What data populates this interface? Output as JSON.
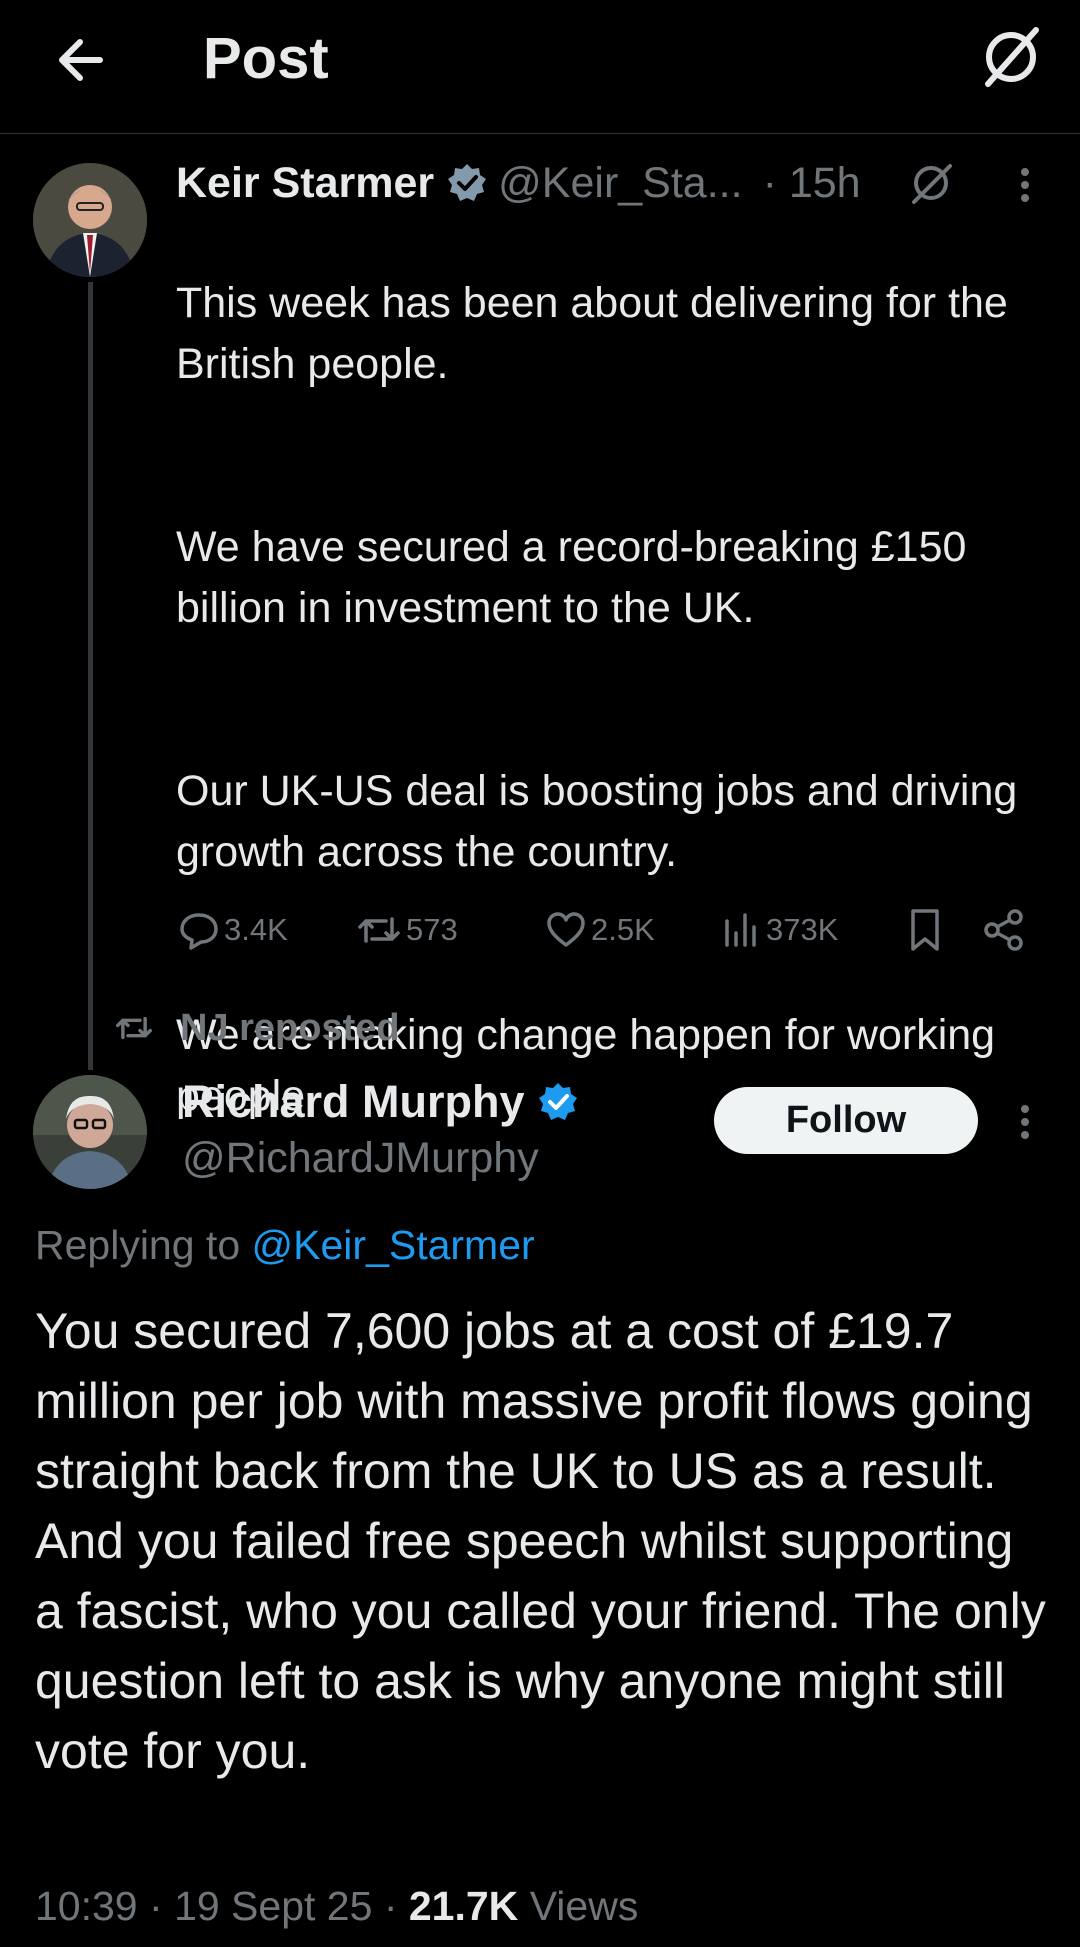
{
  "header": {
    "title": "Post"
  },
  "parent_tweet": {
    "author_name": "Keir Starmer",
    "author_handle": "@Keir_Sta...",
    "time": "· 15h",
    "paragraphs": [
      "This week has been about delivering for the British people.",
      "We have secured a record-breaking £150 billion in investment to the UK.",
      "Our UK-US deal is boosting jobs and driving growth across the country.",
      "We are making change happen for working people."
    ],
    "stats": {
      "replies": "3.4K",
      "reposts": "573",
      "likes": "2.5K",
      "views": "373K"
    }
  },
  "repost_banner": {
    "text": "NJ reposted"
  },
  "main_tweet": {
    "author_name": "Richard Murphy",
    "author_handle": "@RichardJMurphy",
    "follow_label": "Follow",
    "replying_prefix": "Replying to",
    "replying_handle": "@Keir_Starmer",
    "text": "You secured 7,600 jobs at a cost of £19.7 million per job with massive profit flows going straight back from the UK to US as a result. And you failed free speech whilst supporting a fascist, who you called your friend. The only question left to ask is why anyone might still vote for you.",
    "time": "10:39",
    "date": "19 Sept 25",
    "views_count": "21.7K",
    "views_label": "Views"
  },
  "colors": {
    "background": "#000000",
    "text": "#e7e9ea",
    "muted": "#71767b",
    "accent": "#1d9bf0",
    "follow_bg": "#eff3f4"
  },
  "icons": [
    "back-arrow-icon",
    "grok-icon",
    "verified-badge-icon",
    "more-icon",
    "reply-icon",
    "repost-icon",
    "like-icon",
    "views-icon",
    "bookmark-icon",
    "share-icon"
  ]
}
